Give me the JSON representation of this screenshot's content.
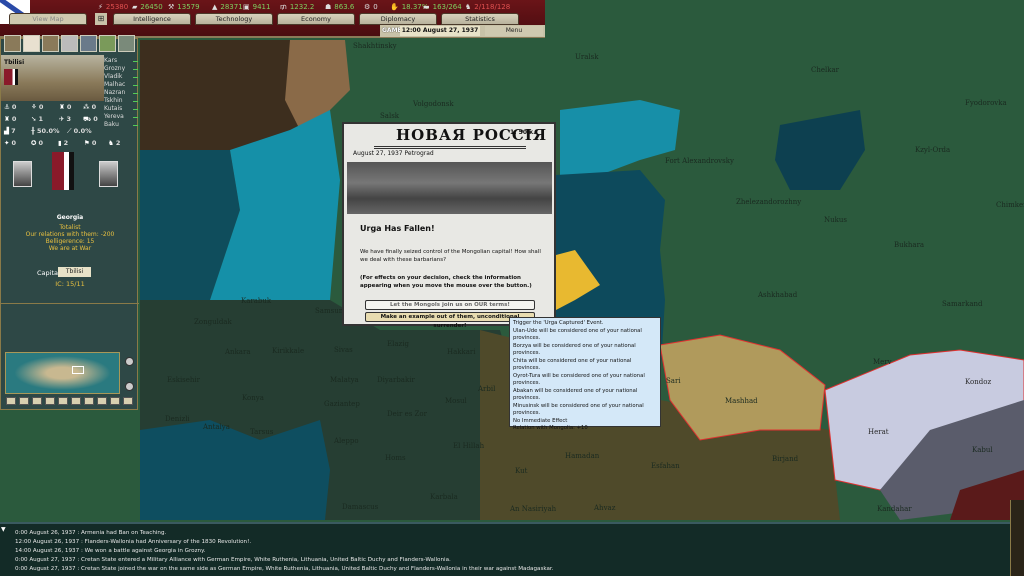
{
  "topbar": {
    "resources": [
      {
        "icon": "energy-icon",
        "value": "25380",
        "color": "#e05050"
      },
      {
        "icon": "metal-icon",
        "value": "26450",
        "color": "#7fd060"
      },
      {
        "icon": "rare-materials-icon",
        "value": "13579",
        "color": "#7fd060"
      },
      {
        "icon": "oil-icon",
        "value": "28371",
        "color": "#7fd060"
      },
      {
        "icon": "supplies-icon",
        "value": "9411",
        "color": "#7fd060"
      },
      {
        "icon": "money-icon",
        "value": "1232.2",
        "color": "#7fd060"
      },
      {
        "icon": "manpower-icon",
        "value": "863.6",
        "color": "#7fd060"
      },
      {
        "icon": "transports-icon",
        "value": "0",
        "color": "#dddddd"
      },
      {
        "icon": "dissent-icon",
        "value": "18.37%",
        "color": "#7fd060"
      },
      {
        "icon": "convoys-icon",
        "value": "163/264",
        "color": "#7fd060"
      },
      {
        "icon": "divisions-icon",
        "value": "2/118/128",
        "color": "#e05050"
      }
    ],
    "tabs": [
      "View Map",
      "Intelligence",
      "Technology",
      "Economy",
      "Diplomacy",
      "Statistics"
    ],
    "status": "GAME PAUSED",
    "date": "12:00 August 27, 1937",
    "menu": "Menu"
  },
  "province": {
    "name": "Tbilisi",
    "cities": [
      "Kars",
      "Grozny",
      "Vladik",
      "Malhac",
      "Nazran",
      "Tskhin",
      "Kutais",
      "Yereva",
      "Baku"
    ],
    "stats": [
      "0",
      "0",
      "0",
      "0",
      "0",
      "1",
      "3",
      "0",
      "7",
      "50.0%",
      "0.0%",
      "0",
      "0",
      "2",
      "0",
      "2"
    ]
  },
  "country": {
    "name": "Georgia",
    "lines": [
      "Totalist",
      "Our relations with them: -200",
      "Belligerence: 15",
      "We are at War"
    ],
    "capital_label": "Capital",
    "capital": "Tbilisi",
    "ic": "IC: 15/11"
  },
  "event": {
    "newspaper": "НОВАЯ РОССIЯ",
    "price": "1: 50 к.",
    "dateline": "August 27, 1937 Petrograd",
    "title": "Urga Has Fallen!",
    "description": "We have finally seized control of the Mongolian capital! How shall we deal with these barbarians?",
    "note": "(For effects on your decision, check the information appearing when you move the mouse over the button.)",
    "options": [
      "Let the Mongols join us on OUR terms!",
      "Make an example out of them, unconditional surrender!"
    ]
  },
  "tooltip": [
    "Trigger the 'Urga Captured' Event.",
    "Ulan-Ude will be considered one of your national provinces.",
    "Borzya will be considered one of your national provinces.",
    "Chita will be considered one of your national provinces.",
    "Oyrot-Tura will be considered one of your national provinces.",
    "Abakan will be considered one of your national provinces.",
    "Minusinsk will be considered one of your national provinces.",
    "No Immediate Effect",
    "Relation with Mongolia: +10"
  ],
  "log": [
    "0:00 August 26, 1937 : Armenia had Ban on Teaching.",
    "12:00 August 26, 1937 : Flanders-Wallonia had Anniversary of the 1830 Revolution!.",
    "14:00 August 26, 1937 : We won a battle against Georgia in Grozny.",
    "0:00 August 27, 1937 : Cretan State entered a Military Alliance with German Empire, White Ruthenia, Lithuania, United Baltic Duchy and Flanders-Wallonia.",
    "0:00 August 27, 1937 : Cretan State joined the war on the same side as German Empire, White Ruthenia, Lithuania, United Baltic Duchy and Flanders-Wallonia in their war against Madagaskar."
  ],
  "map": {
    "labels": [
      "Uralsk",
      "Chelkar",
      "Fyodorovka",
      "Kzyl-Orda",
      "Fort Alexandrovsky",
      "Zhelezandorozhny",
      "Nukus",
      "Bukhara",
      "Chimkent",
      "Ashkhabad",
      "Samarkand",
      "Merv",
      "Kondoz",
      "Herat",
      "Kabul",
      "Kandahar",
      "Sari",
      "Mashhad",
      "Birjand",
      "Esfahan",
      "Hamadan",
      "Ahvaz",
      "Volgodonsk",
      "Salsk",
      "Shakhtinsky",
      "Karabuk",
      "Samsun",
      "Zonguldak",
      "Ankara",
      "Kirikkale",
      "Sivas",
      "Elazig",
      "Hakkari",
      "Eskisehir",
      "Konya",
      "Malatya",
      "Diyarbakir",
      "Mosul",
      "Arbil",
      "Denizli",
      "Antalya",
      "Tarsus",
      "Gaziantep",
      "Deir es Zor",
      "Aleppo",
      "Homs",
      "El Hillah",
      "Kut",
      "Karbala",
      "Damascus",
      "An Nasiriyah"
    ],
    "colors": {
      "land": "#2b5a3d",
      "sea": "#0f4d5c",
      "black_sea": "#1590a8",
      "turkey": "#263e33",
      "iran": "#4f4a2a",
      "mashhad": "#b09a5c",
      "afghan": "#c8cbe0",
      "afghan_south": "#5a5c6b",
      "ukraine": "#3d2e1e",
      "ukraine_light": "#8a6a48",
      "yellow": "#e8b930"
    }
  }
}
